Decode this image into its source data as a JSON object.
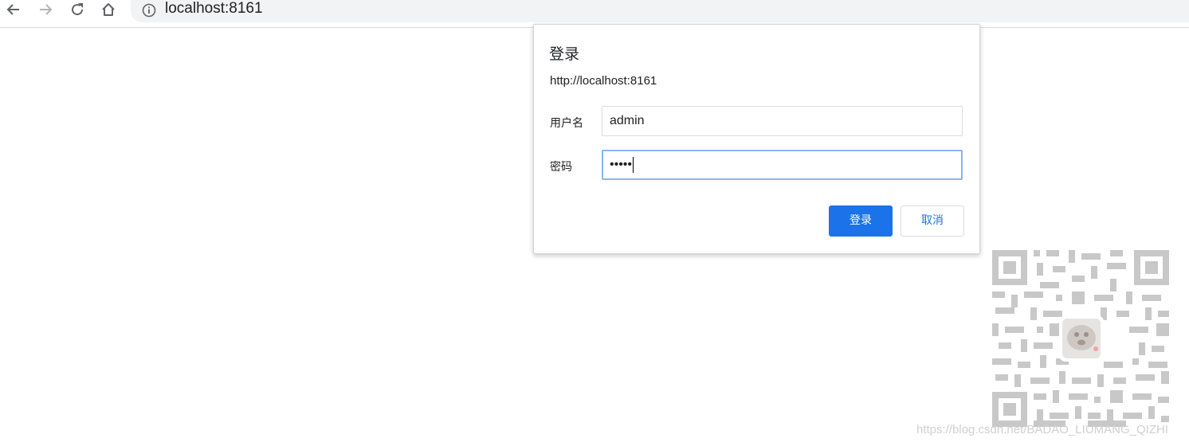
{
  "browser": {
    "url": "localhost:8161",
    "icons": {
      "back": "arrow-left-icon",
      "forward": "arrow-right-icon",
      "reload": "reload-icon",
      "home": "home-icon",
      "info": "info-icon"
    }
  },
  "auth_dialog": {
    "title": "登录",
    "origin": "http://localhost:8161",
    "username_label": "用户名",
    "username_value": "admin",
    "password_label": "密码",
    "password_value": "•••••",
    "login_button": "登录",
    "cancel_button": "取消"
  },
  "watermark": "https://blog.csdn.net/BADAO_LIUMANG_QIZHI",
  "colors": {
    "accent": "#1a73e8",
    "focus_border": "#8ab4f8",
    "omnibox_bg": "#f1f3f4"
  }
}
